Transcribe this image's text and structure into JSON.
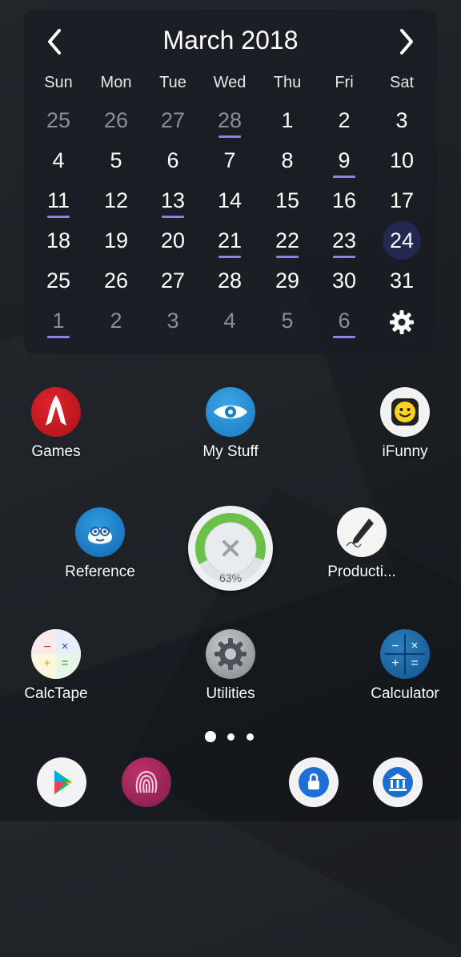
{
  "calendar": {
    "title": "March 2018",
    "weekdays": [
      "Sun",
      "Mon",
      "Tue",
      "Wed",
      "Thu",
      "Fri",
      "Sat"
    ],
    "weeks": [
      [
        {
          "d": "25",
          "m": 1
        },
        {
          "d": "26",
          "m": 1
        },
        {
          "d": "27",
          "m": 1
        },
        {
          "d": "28",
          "m": 1,
          "u": 1
        },
        {
          "d": "1"
        },
        {
          "d": "2"
        },
        {
          "d": "3"
        }
      ],
      [
        {
          "d": "4"
        },
        {
          "d": "5"
        },
        {
          "d": "6"
        },
        {
          "d": "7"
        },
        {
          "d": "8"
        },
        {
          "d": "9",
          "u": 1
        },
        {
          "d": "10"
        }
      ],
      [
        {
          "d": "11",
          "u": 1
        },
        {
          "d": "12"
        },
        {
          "d": "13",
          "u": 1
        },
        {
          "d": "14"
        },
        {
          "d": "15"
        },
        {
          "d": "16"
        },
        {
          "d": "17"
        }
      ],
      [
        {
          "d": "18"
        },
        {
          "d": "19"
        },
        {
          "d": "20"
        },
        {
          "d": "21",
          "u": 1
        },
        {
          "d": "22",
          "u": 1
        },
        {
          "d": "23",
          "u": 1
        },
        {
          "d": "24",
          "today": 1
        }
      ],
      [
        {
          "d": "25"
        },
        {
          "d": "26"
        },
        {
          "d": "27"
        },
        {
          "d": "28"
        },
        {
          "d": "29"
        },
        {
          "d": "30"
        },
        {
          "d": "31"
        }
      ],
      [
        {
          "d": "1",
          "m": 1,
          "u": 1
        },
        {
          "d": "2",
          "m": 1
        },
        {
          "d": "3",
          "m": 1
        },
        {
          "d": "4",
          "m": 1
        },
        {
          "d": "5",
          "m": 1
        },
        {
          "d": "6",
          "m": 1,
          "u": 1
        },
        {
          "d": "",
          "gear": 1
        }
      ]
    ],
    "accent_color": "#3b48c7",
    "event_underline_color": "#8a84e6",
    "icons": {
      "prev": "chevron-left-icon",
      "next": "chevron-right-icon",
      "settings": "gear-icon"
    }
  },
  "apps": {
    "games": "Games",
    "my_stuff": "My Stuff",
    "ifunny": "iFunny",
    "reference": "Reference",
    "productivity": "Producti...",
    "calctape": "CalcTape",
    "utilities": "Utilities",
    "calculator": "Calculator"
  },
  "booster": {
    "percent_label": "63%",
    "percent": 0.63,
    "color": "#6cc04a"
  },
  "pager": {
    "pages": 3,
    "current": 1
  },
  "dock": [
    "play-store-icon",
    "fingerprint-app-icon",
    "lock-app-icon",
    "bank-app-icon"
  ]
}
